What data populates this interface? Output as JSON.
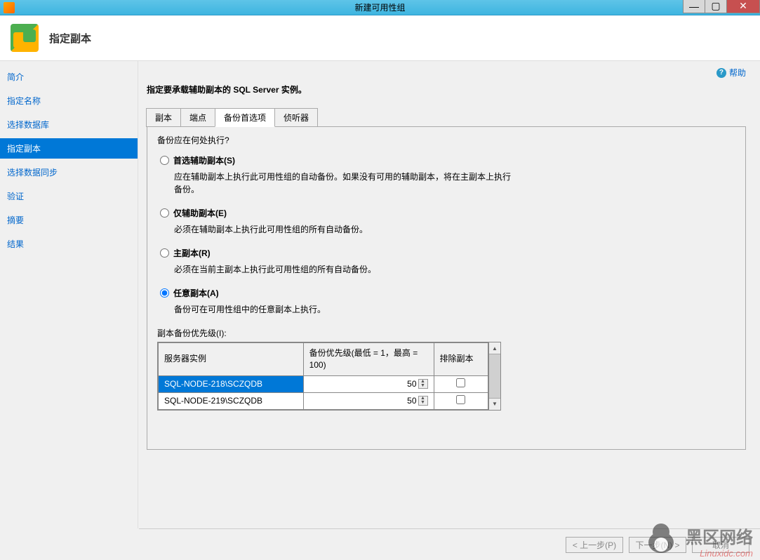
{
  "window": {
    "title": "新建可用性组"
  },
  "header": {
    "title": "指定副本"
  },
  "sidebar": {
    "items": [
      {
        "label": "简介",
        "active": false
      },
      {
        "label": "指定名称",
        "active": false
      },
      {
        "label": "选择数据库",
        "active": false
      },
      {
        "label": "指定副本",
        "active": true
      },
      {
        "label": "选择数据同步",
        "active": false
      },
      {
        "label": "验证",
        "active": false
      },
      {
        "label": "摘要",
        "active": false
      },
      {
        "label": "结果",
        "active": false
      }
    ]
  },
  "help": {
    "label": "帮助"
  },
  "content": {
    "instruction": "指定要承载辅助副本的 SQL Server 实例。",
    "tabs": [
      {
        "label": "副本",
        "active": false
      },
      {
        "label": "端点",
        "active": false
      },
      {
        "label": "备份首选项",
        "active": true
      },
      {
        "label": "侦听器",
        "active": false
      }
    ],
    "question": "备份应在何处执行?",
    "radios": [
      {
        "label": "首选辅助副本(S)",
        "desc": "应在辅助副本上执行此可用性组的自动备份。如果没有可用的辅助副本，将在主副本上执行备份。",
        "checked": false
      },
      {
        "label": "仅辅助副本(E)",
        "desc": "必须在辅助副本上执行此可用性组的所有自动备份。",
        "checked": false
      },
      {
        "label": "主副本(R)",
        "desc": "必须在当前主副本上执行此可用性组的所有自动备份。",
        "checked": false
      },
      {
        "label": "任意副本(A)",
        "desc": "备份可在可用性组中的任意副本上执行。",
        "checked": true
      }
    ],
    "priority_label": "副本备份优先级(I):",
    "table": {
      "headers": {
        "server": "服务器实例",
        "priority": "备份优先级(最低 = 1，最高 = 100)",
        "exclude": "排除副本"
      },
      "rows": [
        {
          "server": "SQL-NODE-218\\SCZQDB",
          "priority": "50",
          "excluded": false,
          "selected": true
        },
        {
          "server": "SQL-NODE-219\\SCZQDB",
          "priority": "50",
          "excluded": false,
          "selected": false
        }
      ]
    }
  },
  "footer": {
    "prev": "< 上一步(P)",
    "next": "下一步(N) >",
    "cancel": "取消"
  },
  "watermark": {
    "main": "黑区网络",
    "sub": "Linuxidc.com"
  }
}
